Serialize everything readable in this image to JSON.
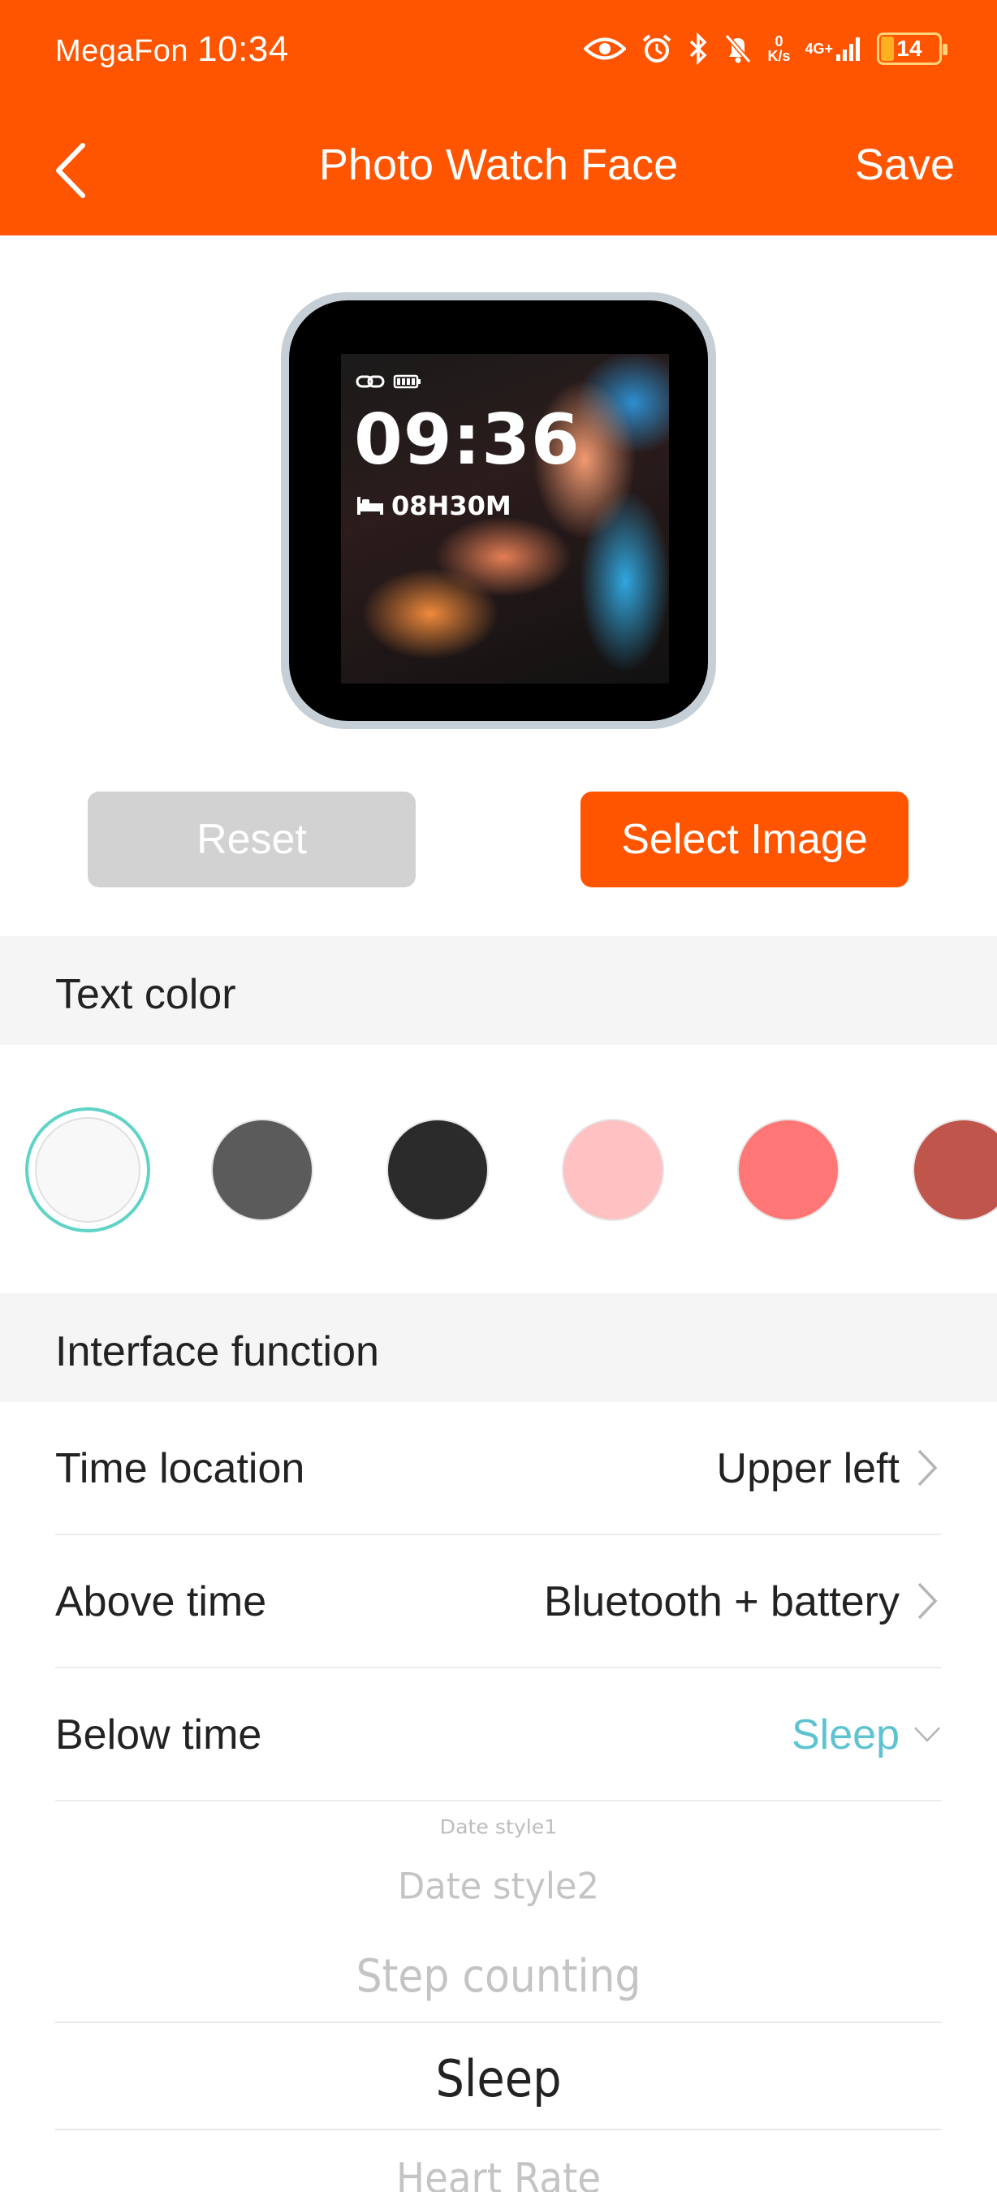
{
  "status_bar": {
    "carrier": "MegaFon",
    "time": "10:34",
    "net_speed_value": "0",
    "net_speed_unit": "K/s",
    "network": "4G+",
    "battery": "14"
  },
  "header": {
    "title": "Photo Watch Face",
    "save_label": "Save",
    "background_color": "#ff5500"
  },
  "watch_preview": {
    "time": "09:36",
    "sleep": "08H30M"
  },
  "actions": {
    "reset_label": "Reset",
    "select_image_label": "Select Image"
  },
  "text_color": {
    "heading": "Text color",
    "swatches": [
      "#f8f8f8",
      "#5b5b5b",
      "#2b2b2b",
      "#ffc1c1",
      "#ff7676",
      "#c0554c"
    ],
    "selected_index": 0,
    "selected_ring_color": "#5ed3c6"
  },
  "interface_function": {
    "heading": "Interface function",
    "rows": [
      {
        "label": "Time location",
        "value": "Upper left"
      },
      {
        "label": "Above time",
        "value": "Bluetooth + battery"
      },
      {
        "label": "Below time",
        "value": "Sleep"
      }
    ]
  },
  "picker": {
    "options": [
      "Date style1",
      "Date style2",
      "Step counting",
      "Sleep",
      "Heart Rate"
    ],
    "selected": "Sleep"
  }
}
